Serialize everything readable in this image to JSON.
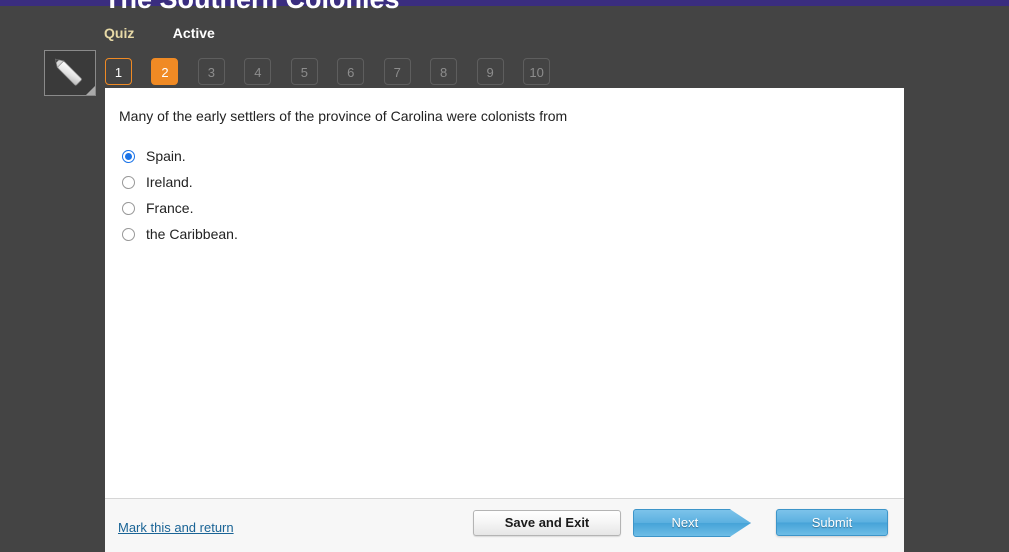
{
  "theme": {
    "top_strip_color": "#3a2d7f",
    "page_background": "#444444",
    "accent_orange": "#f08a24",
    "tab_quiz_color": "#e7d9a6",
    "link_blue": "#1a6496",
    "button_blue": "#5bb0e0",
    "radio_selected_blue": "#1a73e8"
  },
  "header": {
    "title": "The Southern Colonies",
    "tabs": [
      {
        "label": "Quiz",
        "state": "selected"
      },
      {
        "label": "Active",
        "state": "normal"
      }
    ]
  },
  "toolbar": {
    "tool_icon": "pencil-icon"
  },
  "pager": {
    "buttons": [
      {
        "label": "1",
        "state": "visited"
      },
      {
        "label": "2",
        "state": "current"
      },
      {
        "label": "3",
        "state": "disabled"
      },
      {
        "label": "4",
        "state": "disabled"
      },
      {
        "label": "5",
        "state": "disabled"
      },
      {
        "label": "6",
        "state": "disabled"
      },
      {
        "label": "7",
        "state": "disabled"
      },
      {
        "label": "8",
        "state": "disabled"
      },
      {
        "label": "9",
        "state": "disabled"
      },
      {
        "label": "10",
        "state": "disabled"
      }
    ]
  },
  "question": {
    "text": "Many of the early settlers of the province of Carolina were colonists from",
    "options": [
      {
        "label": "Spain.",
        "selected": true
      },
      {
        "label": "Ireland.",
        "selected": false
      },
      {
        "label": "France.",
        "selected": false
      },
      {
        "label": "the Caribbean.",
        "selected": false
      }
    ]
  },
  "footer": {
    "mark_link": "Mark this and return",
    "save_label": "Save and Exit",
    "next_label": "Next",
    "submit_label": "Submit"
  }
}
